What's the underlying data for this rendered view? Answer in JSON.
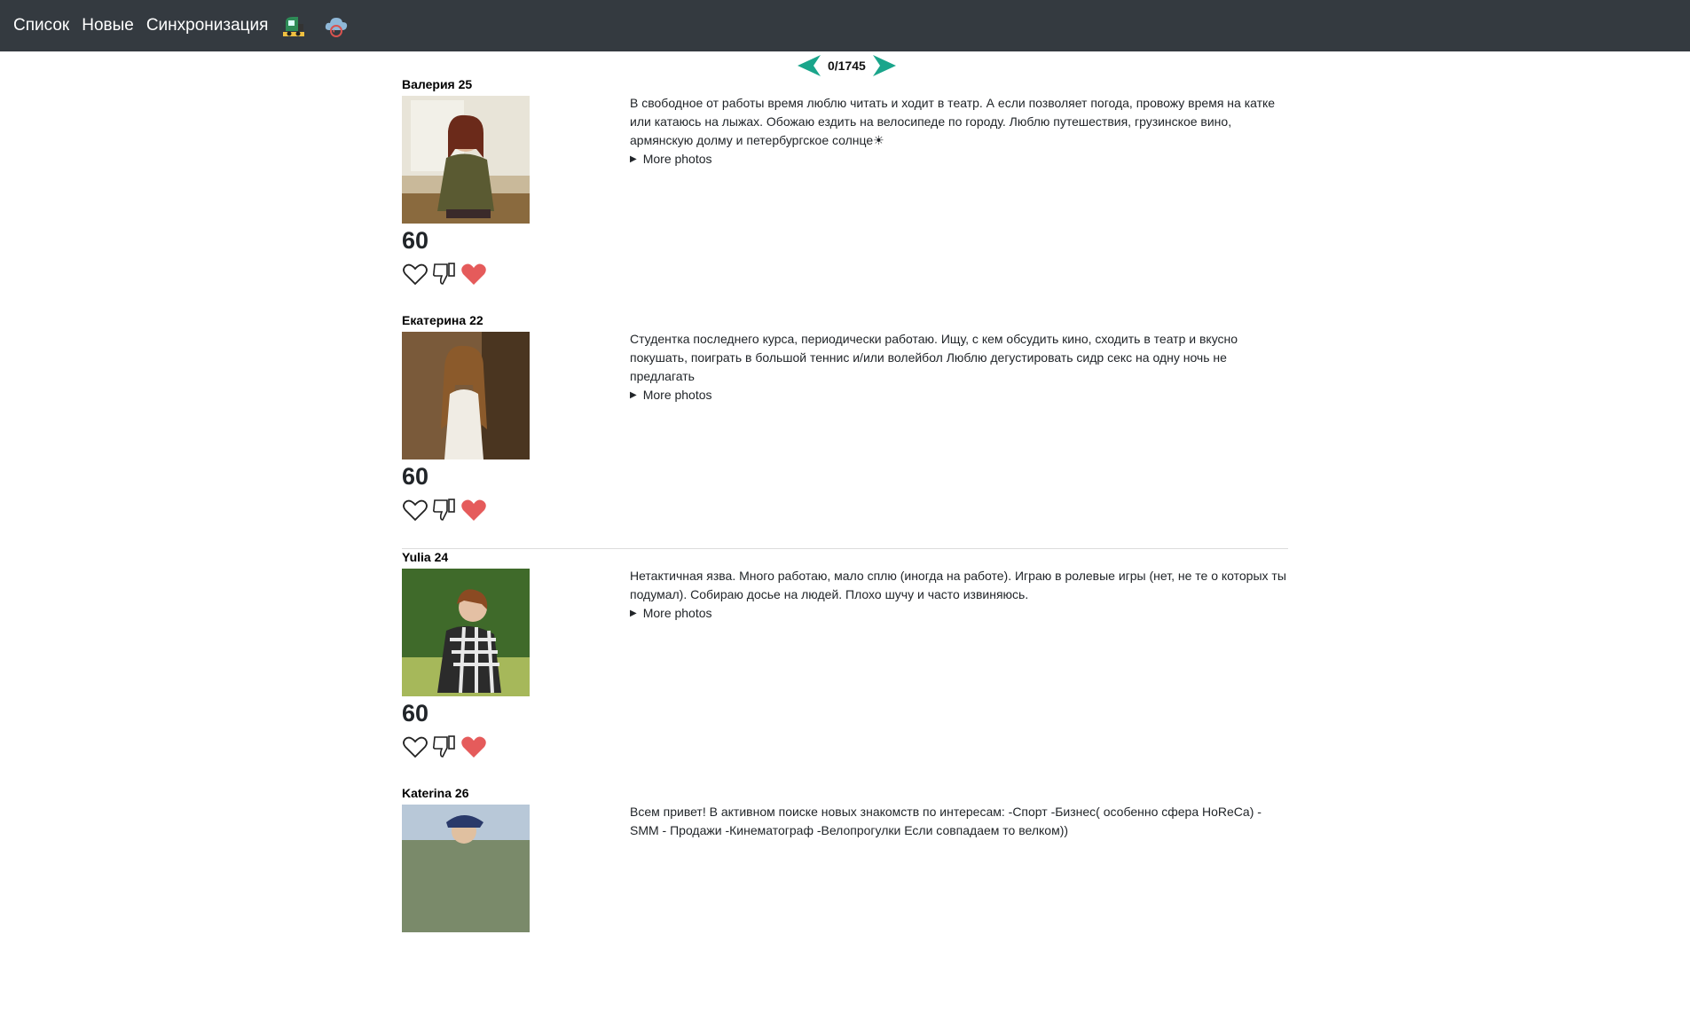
{
  "nav": {
    "list_label": "Список",
    "new_label": "Новые",
    "sync_label": "Синхронизация"
  },
  "pager": {
    "count": "0/1745"
  },
  "colors": {
    "navbar": "#343a40",
    "accent": "#1aa58b",
    "heart": "#e55b5b"
  },
  "profiles": [
    {
      "name": "Валерия 25",
      "score": "60",
      "bio": "В свободное от работы время люблю читать и ходит в театр. А если позволяет погода, провожу время на катке или катаюсь на лыжах. Обожаю ездить на велосипеде по городу. Люблю путешествия, грузинское вино, армянскую долму и петербургское солнце☀",
      "more": "More photos"
    },
    {
      "name": "Екатерина 22",
      "score": "60",
      "bio": "Студентка последнего курса, периодически работаю. Ищу, с кем обсудить кино, сходить в театр и вкусно покушать, поиграть в большой теннис и/или волейбол Люблю дегустировать сидр секс на одну ночь не предлагать",
      "more": "More photos"
    },
    {
      "name": "Yulia 24",
      "score": "60",
      "bio": "Нетактичная язва. Много работаю, мало сплю (иногда на работе). Играю в ролевые игры (нет, не те о которых ты подумал). Собираю досье на людей. Плохо шучу и часто извиняюсь.",
      "more": "More photos"
    },
    {
      "name": "Katerina 26",
      "score": "",
      "bio": "Всем привет! В активном поиске новых знакомств по интересам: -Спорт -Бизнес( особенно сфера HoReCa) - SMM - Продажи -Кинематограф -Велопрогулки Если совпадаем то велком))",
      "more": ""
    }
  ]
}
